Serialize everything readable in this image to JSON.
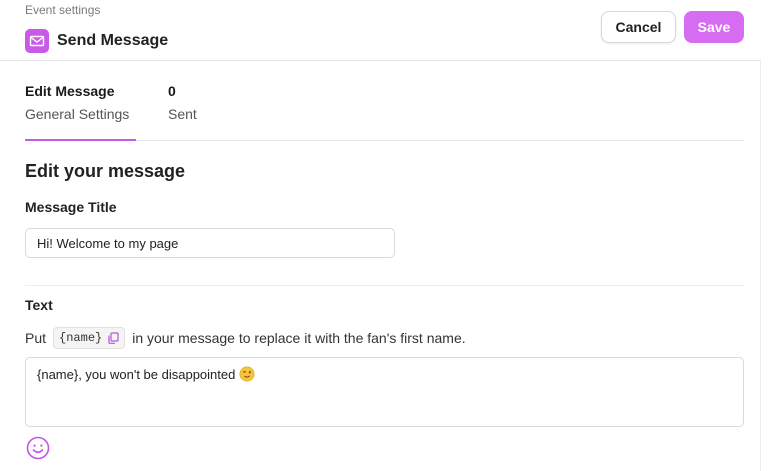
{
  "header": {
    "breadcrumb": "Event settings",
    "title": "Send Message",
    "cancel_label": "Cancel",
    "save_label": "Save",
    "icon": "mail-icon"
  },
  "tabs": [
    {
      "value": "Edit Message",
      "label": "General Settings",
      "active": true
    },
    {
      "value": "0",
      "label": "Sent",
      "active": false
    }
  ],
  "form": {
    "section_heading": "Edit your message",
    "title_label": "Message Title",
    "title_value": "Hi! Welcome to my page",
    "text_label": "Text",
    "hint_prefix": "Put",
    "hint_token": "{name}",
    "hint_suffix": "in your message to replace it with the fan's first name.",
    "text_value": "{name}, you won't be disappointed"
  },
  "colors": {
    "accent": "#c85ae8",
    "save_button": "#d66cf2"
  }
}
